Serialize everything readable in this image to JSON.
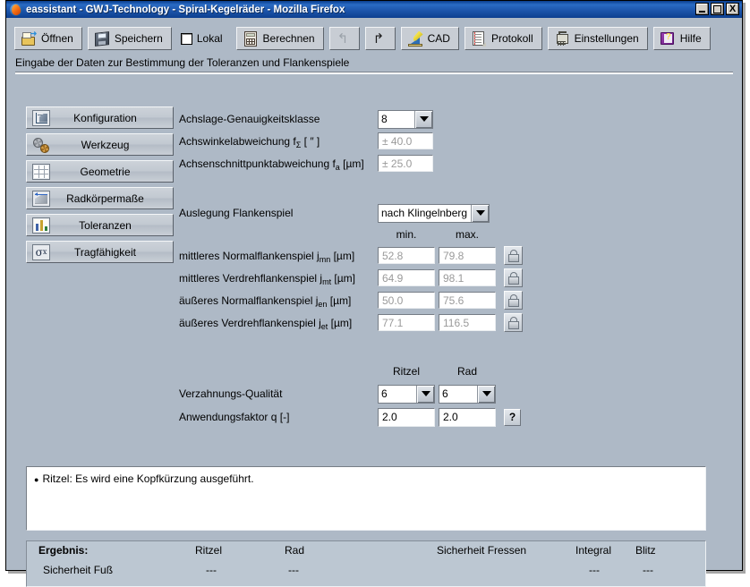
{
  "window": {
    "title": "eassistant - GWJ-Technology - Spiral-Kegelräder - Mozilla Firefox",
    "minimize_label": "_",
    "maximize_label": "□",
    "close_label": "X"
  },
  "toolbar": {
    "buttons": [
      {
        "label": "Öffnen",
        "icon": "open-folder-icon"
      },
      {
        "label": "Speichern",
        "icon": "floppy-disk-icon"
      },
      {
        "label": "Lokal",
        "icon": "checkbox-icon"
      },
      {
        "label": "Berechnen",
        "icon": "calculator-icon"
      },
      {
        "label": "",
        "icon": "undo-icon"
      },
      {
        "label": "",
        "icon": "redo-icon"
      },
      {
        "label": "CAD",
        "icon": "cad-pencil-ruler-icon"
      },
      {
        "label": "Protokoll",
        "icon": "document-icon"
      },
      {
        "label": "Einstellungen",
        "icon": "settings-tool-icon"
      },
      {
        "label": "Hilfe",
        "icon": "help-book-icon"
      }
    ]
  },
  "caption": "Eingabe der Daten zur Bestimmung der Toleranzen und Flankenspiele",
  "sidebar": {
    "items": [
      {
        "label": "Konfiguration",
        "icon": "axes-diagram-icon"
      },
      {
        "label": "Werkzeug",
        "icon": "gears-icon"
      },
      {
        "label": "Geometrie",
        "icon": "grid-icon"
      },
      {
        "label": "Radkörpermaße",
        "icon": "dimension-arrow-icon"
      },
      {
        "label": "Toleranzen",
        "icon": "bar-chart-icon"
      },
      {
        "label": "Tragfähigkeit",
        "icon": "sigma-x-icon"
      }
    ]
  },
  "form": {
    "accuracy_class_label": "Achslage-Genauigkeitsklasse",
    "accuracy_class_value": "8",
    "axis_angle_dev_label_pre": "Achswinkelabweichung f",
    "axis_angle_dev_label_sub": "Σ",
    "axis_angle_dev_label_post": " [ ″ ]",
    "axis_angle_dev_value": "± 40.0",
    "axis_intersect_dev_label_pre": "Achsenschnittpunktabweichung f",
    "axis_intersect_dev_label_sub": "a",
    "axis_intersect_dev_label_post": " [µm]",
    "axis_intersect_dev_value": "± 25.0",
    "backlash_design_label": "Auslegung Flankenspiel",
    "backlash_design_value": "nach Klingelnberg",
    "col_min": "min.",
    "col_max": "max.",
    "backlash_rows": [
      {
        "label_pre": "mittleres Normalflankenspiel j",
        "label_sub": "mn",
        "label_post": " [µm]",
        "min": "52.8",
        "max": "79.8",
        "lock": "lock-icon"
      },
      {
        "label_pre": "mittleres Verdrehflankenspiel j",
        "label_sub": "mt",
        "label_post": " [µm]",
        "min": "64.9",
        "max": "98.1",
        "lock": "lock-icon"
      },
      {
        "label_pre": "äußeres Normalflankenspiel j",
        "label_sub": "en",
        "label_post": " [µm]",
        "min": "50.0",
        "max": "75.6",
        "lock": "lock-icon"
      },
      {
        "label_pre": "äußeres Verdrehflankenspiel j",
        "label_sub": "et",
        "label_post": " [µm]",
        "min": "77.1",
        "max": "116.5",
        "lock": "lock-icon"
      }
    ],
    "col_ritzel": "Ritzel",
    "col_rad": "Rad",
    "quality_label": "Verzahnungs-Qualität",
    "quality_ritzel": "6",
    "quality_rad": "6",
    "factor_label": "Anwendungsfaktor q [-]",
    "factor_ritzel": "2.0",
    "factor_rad": "2.0",
    "factor_help": "?"
  },
  "messages": {
    "bullet": "●",
    "items": [
      "Ritzel: Es wird eine Kopfkürzung ausgeführt."
    ]
  },
  "result": {
    "title": "Ergebnis:",
    "header_ritzel": "Ritzel",
    "header_rad": "Rad",
    "header_fressen": "Sicherheit Fressen",
    "header_integral": "Integral",
    "header_blitz": "Blitz",
    "row_label": "Sicherheit Fuß",
    "row_ritzel": "---",
    "row_rad": "---",
    "row_integral": "---",
    "row_blitz": "---"
  }
}
